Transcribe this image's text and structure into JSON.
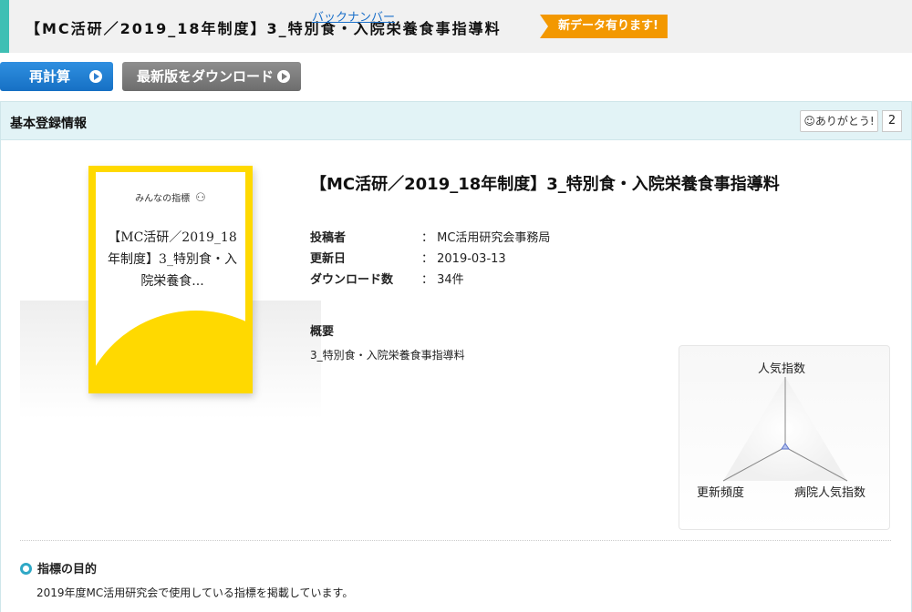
{
  "header": {
    "title": "【MC活研／2019_18年制度】3_特別食・入院栄養食事指導料",
    "badge": "新データ有ります!"
  },
  "toolbar": {
    "recalc_label": "再計算",
    "download_label": "最新版をダウンロード",
    "backnumber_label": "バックナンバー"
  },
  "panel": {
    "heading": "基本登録情報",
    "thanks_label": "☺ありがとう!",
    "thanks_count": "2"
  },
  "cover": {
    "brand": "みんなの指標",
    "title": "【MC活研／2019_18年制度】3_特別食・入院栄養食..."
  },
  "details": {
    "title": "【MC活研／2019_18年制度】3_特別食・入院栄養食事指導料",
    "meta": [
      {
        "key": "投稿者",
        "value": "： MC活用研究会事務局"
      },
      {
        "key": "更新日",
        "value": "： 2019-03-13"
      },
      {
        "key": "ダウンロード数",
        "value": "： 34件"
      }
    ],
    "overview_heading": "概要",
    "overview_text": "3_特別食・入院栄養食事指導料"
  },
  "radar": {
    "labels": {
      "top": "人気指数",
      "left": "更新頻度",
      "right": "病院人気指数"
    }
  },
  "purpose": {
    "heading": "指標の目的",
    "text": "2019年度MC活用研究会で使用している指標を掲載しています。"
  },
  "colors": {
    "accent": "#3fbfb4",
    "badge": "#f39800",
    "primary_button": "#1f7fd6",
    "cover_yellow": "#ffd900",
    "link": "#1a6fc9"
  }
}
